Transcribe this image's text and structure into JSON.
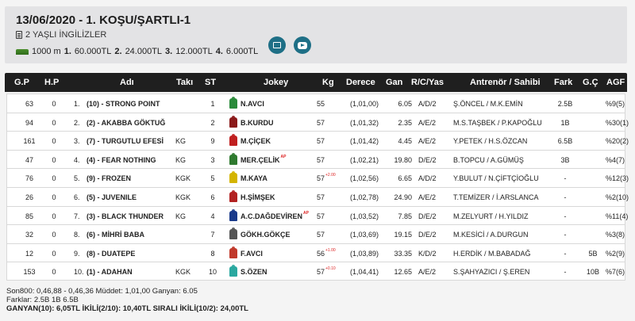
{
  "header": {
    "title": "13/06/2020 - 1. KOŞU/ŞARTLI-1",
    "subtitle": "2 YAŞLI İNGİLİZLER",
    "distance": "1000 m",
    "prizes": [
      {
        "rank": "1.",
        "amount": "60.000TL"
      },
      {
        "rank": "2.",
        "amount": "24.000TL"
      },
      {
        "rank": "3.",
        "amount": "12.000TL"
      },
      {
        "rank": "4.",
        "amount": "6.000TL"
      }
    ],
    "photo_icon": "photo-icon",
    "video_icon": "youtube-icon"
  },
  "columns": {
    "gp": "G.P",
    "hp": "H.P",
    "name": "Adı",
    "equip": "Takı",
    "st": "ST",
    "jockey": "Jokey",
    "kg": "Kg",
    "degree": "Derece",
    "gan": "Gan",
    "rcyas": "R/C/Yas",
    "trainer": "Antrenör / Sahibi",
    "fark": "Fark",
    "gc": "G.Ç",
    "agf": "AGF"
  },
  "rows": [
    {
      "gp": "63",
      "hp": "0",
      "rank": "1.",
      "name": "(10) - STRONG POINT",
      "equip": "",
      "st": "1",
      "silk": "#2a8a3a",
      "jockey": "N.AVCI",
      "jockey_mark": "",
      "kg": "55",
      "kg_note": "",
      "degree": "(1,01,00)",
      "gan": "6.05",
      "rcyas": "A/D/2",
      "trainer": "Ş.ÖNCEL / M.K.EMİN",
      "fark": "2.5B",
      "gc": "",
      "agf": "%9(5)"
    },
    {
      "gp": "94",
      "hp": "0",
      "rank": "2.",
      "name": "(2) - AKABBA GÖKTUĞ",
      "equip": "",
      "st": "2",
      "silk": "#8b1a1a",
      "jockey": "B.KURDU",
      "jockey_mark": "",
      "kg": "57",
      "kg_note": "",
      "degree": "(1,01,32)",
      "gan": "2.35",
      "rcyas": "A/E/2",
      "trainer": "M.S.TAŞBEK / P.KAPOĞLU",
      "fark": "1B",
      "gc": "",
      "agf": "%30(1)"
    },
    {
      "gp": "161",
      "hp": "0",
      "rank": "3.",
      "name": "(7) - TURGUTLU EFESİ",
      "equip": "KG",
      "st": "9",
      "silk": "#c02020",
      "jockey": "M.ÇİÇEK",
      "jockey_mark": "",
      "kg": "57",
      "kg_note": "",
      "degree": "(1,01,42)",
      "gan": "4.45",
      "rcyas": "A/E/2",
      "trainer": "Y.PETEK / H.S.ÖZCAN",
      "fark": "6.5B",
      "gc": "",
      "agf": "%20(2)"
    },
    {
      "gp": "47",
      "hp": "0",
      "rank": "4.",
      "name": "(4) - FEAR NOTHING",
      "equip": "KG",
      "st": "3",
      "silk": "#2f7a2f",
      "jockey": "MER.ÇELİK",
      "jockey_mark": "AP",
      "kg": "57",
      "kg_note": "",
      "degree": "(1,02,21)",
      "gan": "19.80",
      "rcyas": "D/E/2",
      "trainer": "B.TOPCU / A.GÜMÜŞ",
      "fark": "3B",
      "gc": "",
      "agf": "%4(7)"
    },
    {
      "gp": "76",
      "hp": "0",
      "rank": "5.",
      "name": "(9) - FROZEN",
      "equip": "KGK",
      "st": "5",
      "silk": "#d4b400",
      "jockey": "M.KAYA",
      "jockey_mark": "",
      "kg": "57",
      "kg_note": "+2.00",
      "degree": "(1,02,56)",
      "gan": "6.65",
      "rcyas": "A/D/2",
      "trainer": "Y.BULUT / N.ÇİFTÇİOĞLU",
      "fark": "-",
      "gc": "",
      "agf": "%12(3)"
    },
    {
      "gp": "26",
      "hp": "0",
      "rank": "6.",
      "name": "(5) - JUVENILE",
      "equip": "KGK",
      "st": "6",
      "silk": "#b22222",
      "jockey": "H.ŞİMŞEK",
      "jockey_mark": "",
      "kg": "57",
      "kg_note": "",
      "degree": "(1,02,78)",
      "gan": "24.90",
      "rcyas": "A/E/2",
      "trainer": "T.TEMİZER / İ.ARSLANCA",
      "fark": "-",
      "gc": "",
      "agf": "%2(10)"
    },
    {
      "gp": "85",
      "hp": "0",
      "rank": "7.",
      "name": "(3) - BLACK THUNDER",
      "equip": "KG",
      "st": "4",
      "silk": "#1a3a8a",
      "jockey": "A.C.DAĞDEVİREN",
      "jockey_mark": "AP",
      "kg": "57",
      "kg_note": "",
      "degree": "(1,03,52)",
      "gan": "7.85",
      "rcyas": "D/E/2",
      "trainer": "M.ZELYURT / H.YILDIZ",
      "fark": "-",
      "gc": "",
      "agf": "%11(4)"
    },
    {
      "gp": "32",
      "hp": "0",
      "rank": "8.",
      "name": "(6) - MİHRİ BABA",
      "equip": "",
      "st": "7",
      "silk": "#555555",
      "jockey": "GÖKH.GÖKÇE",
      "jockey_mark": "",
      "kg": "57",
      "kg_note": "",
      "degree": "(1,03,69)",
      "gan": "19.15",
      "rcyas": "D/E/2",
      "trainer": "M.KESİCİ / A.DURGUN",
      "fark": "-",
      "gc": "",
      "agf": "%3(8)"
    },
    {
      "gp": "12",
      "hp": "0",
      "rank": "9.",
      "name": "(8) - DUATEPE",
      "equip": "",
      "st": "8",
      "silk": "#c0392b",
      "jockey": "F.AVCI",
      "jockey_mark": "",
      "kg": "56",
      "kg_note": "+1.00",
      "degree": "(1,03,89)",
      "gan": "33.35",
      "rcyas": "K/D/2",
      "trainer": "H.ERDİK / M.BABADAĞ",
      "fark": "-",
      "gc": "5B",
      "agf": "%2(9)"
    },
    {
      "gp": "153",
      "hp": "0",
      "rank": "10.",
      "name": "(1) - ADAHAN",
      "equip": "KGK",
      "st": "10",
      "silk": "#2aa8a0",
      "jockey": "S.ÖZEN",
      "jockey_mark": "",
      "kg": "57",
      "kg_note": "+0.10",
      "degree": "(1,04,41)",
      "gan": "12.65",
      "rcyas": "A/E/2",
      "trainer": "S.ŞAHYAZICI / Ş.EREN",
      "fark": "-",
      "gc": "10B",
      "agf": "%7(6)"
    }
  ],
  "footer": {
    "line1": "Son800: 0,46,88 - 0,46,36 Müddet: 1,01,00 Ganyan: 6.05",
    "line2": "Farklar: 2.5B 1B 6.5B",
    "line3": "GANYAN(10): 6,05TL İKİLİ(2/10): 10,40TL SIRALI İKİLİ(10/2): 24,00TL"
  }
}
